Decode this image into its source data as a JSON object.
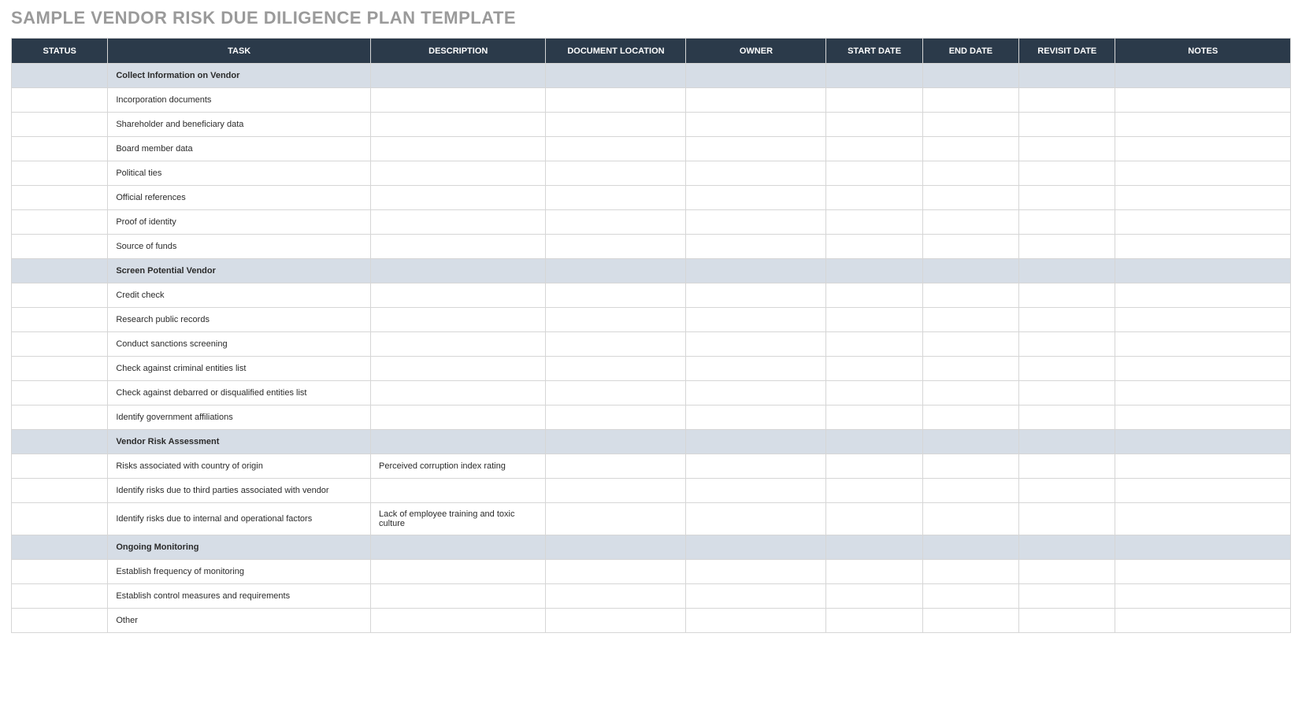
{
  "title": "SAMPLE VENDOR RISK DUE DILIGENCE PLAN TEMPLATE",
  "headers": {
    "status": "STATUS",
    "task": "TASK",
    "description": "DESCRIPTION",
    "location": "DOCUMENT LOCATION",
    "owner": "OWNER",
    "start": "START DATE",
    "end": "END DATE",
    "revisit": "REVISIT DATE",
    "notes": "NOTES"
  },
  "rows": [
    {
      "type": "section",
      "task": "Collect Information on Vendor",
      "description": "",
      "location": "",
      "owner": "",
      "start": "",
      "end": "",
      "revisit": "",
      "notes": ""
    },
    {
      "type": "item",
      "task": "Incorporation documents",
      "description": "",
      "location": "",
      "owner": "",
      "start": "",
      "end": "",
      "revisit": "",
      "notes": ""
    },
    {
      "type": "item",
      "task": "Shareholder and beneficiary data",
      "description": "",
      "location": "",
      "owner": "",
      "start": "",
      "end": "",
      "revisit": "",
      "notes": ""
    },
    {
      "type": "item",
      "task": "Board member data",
      "description": "",
      "location": "",
      "owner": "",
      "start": "",
      "end": "",
      "revisit": "",
      "notes": ""
    },
    {
      "type": "item",
      "task": "Political ties",
      "description": "",
      "location": "",
      "owner": "",
      "start": "",
      "end": "",
      "revisit": "",
      "notes": ""
    },
    {
      "type": "item",
      "task": "Official references",
      "description": "",
      "location": "",
      "owner": "",
      "start": "",
      "end": "",
      "revisit": "",
      "notes": ""
    },
    {
      "type": "item",
      "task": "Proof of identity",
      "description": "",
      "location": "",
      "owner": "",
      "start": "",
      "end": "",
      "revisit": "",
      "notes": ""
    },
    {
      "type": "item",
      "task": "Source of funds",
      "description": "",
      "location": "",
      "owner": "",
      "start": "",
      "end": "",
      "revisit": "",
      "notes": ""
    },
    {
      "type": "section",
      "task": "Screen Potential Vendor",
      "description": "",
      "location": "",
      "owner": "",
      "start": "",
      "end": "",
      "revisit": "",
      "notes": ""
    },
    {
      "type": "item",
      "task": "Credit check",
      "description": "",
      "location": "",
      "owner": "",
      "start": "",
      "end": "",
      "revisit": "",
      "notes": ""
    },
    {
      "type": "item",
      "task": "Research public records",
      "description": "",
      "location": "",
      "owner": "",
      "start": "",
      "end": "",
      "revisit": "",
      "notes": ""
    },
    {
      "type": "item",
      "task": "Conduct sanctions screening",
      "description": "",
      "location": "",
      "owner": "",
      "start": "",
      "end": "",
      "revisit": "",
      "notes": ""
    },
    {
      "type": "item",
      "task": "Check against criminal entities list",
      "description": "",
      "location": "",
      "owner": "",
      "start": "",
      "end": "",
      "revisit": "",
      "notes": ""
    },
    {
      "type": "item",
      "task": "Check against debarred or disqualified entities list",
      "description": "",
      "location": "",
      "owner": "",
      "start": "",
      "end": "",
      "revisit": "",
      "notes": ""
    },
    {
      "type": "item",
      "task": "Identify government affiliations",
      "description": "",
      "location": "",
      "owner": "",
      "start": "",
      "end": "",
      "revisit": "",
      "notes": ""
    },
    {
      "type": "section",
      "task": "Vendor Risk Assessment",
      "description": "",
      "location": "",
      "owner": "",
      "start": "",
      "end": "",
      "revisit": "",
      "notes": ""
    },
    {
      "type": "item",
      "task": "Risks associated with country of origin",
      "description": "Perceived corruption index rating",
      "location": "",
      "owner": "",
      "start": "",
      "end": "",
      "revisit": "",
      "notes": ""
    },
    {
      "type": "item",
      "task": "Identify risks due to third parties associated with vendor",
      "description": "",
      "location": "",
      "owner": "",
      "start": "",
      "end": "",
      "revisit": "",
      "notes": ""
    },
    {
      "type": "item",
      "task": "Identify risks due to internal and operational factors",
      "description": "Lack of employee training and toxic culture",
      "location": "",
      "owner": "",
      "start": "",
      "end": "",
      "revisit": "",
      "notes": ""
    },
    {
      "type": "section",
      "task": "Ongoing Monitoring",
      "description": "",
      "location": "",
      "owner": "",
      "start": "",
      "end": "",
      "revisit": "",
      "notes": ""
    },
    {
      "type": "item",
      "task": "Establish frequency of monitoring",
      "description": "",
      "location": "",
      "owner": "",
      "start": "",
      "end": "",
      "revisit": "",
      "notes": ""
    },
    {
      "type": "item",
      "task": "Establish control measures and requirements",
      "description": "",
      "location": "",
      "owner": "",
      "start": "",
      "end": "",
      "revisit": "",
      "notes": ""
    },
    {
      "type": "item",
      "task": "Other",
      "description": "",
      "location": "",
      "owner": "",
      "start": "",
      "end": "",
      "revisit": "",
      "notes": ""
    }
  ]
}
